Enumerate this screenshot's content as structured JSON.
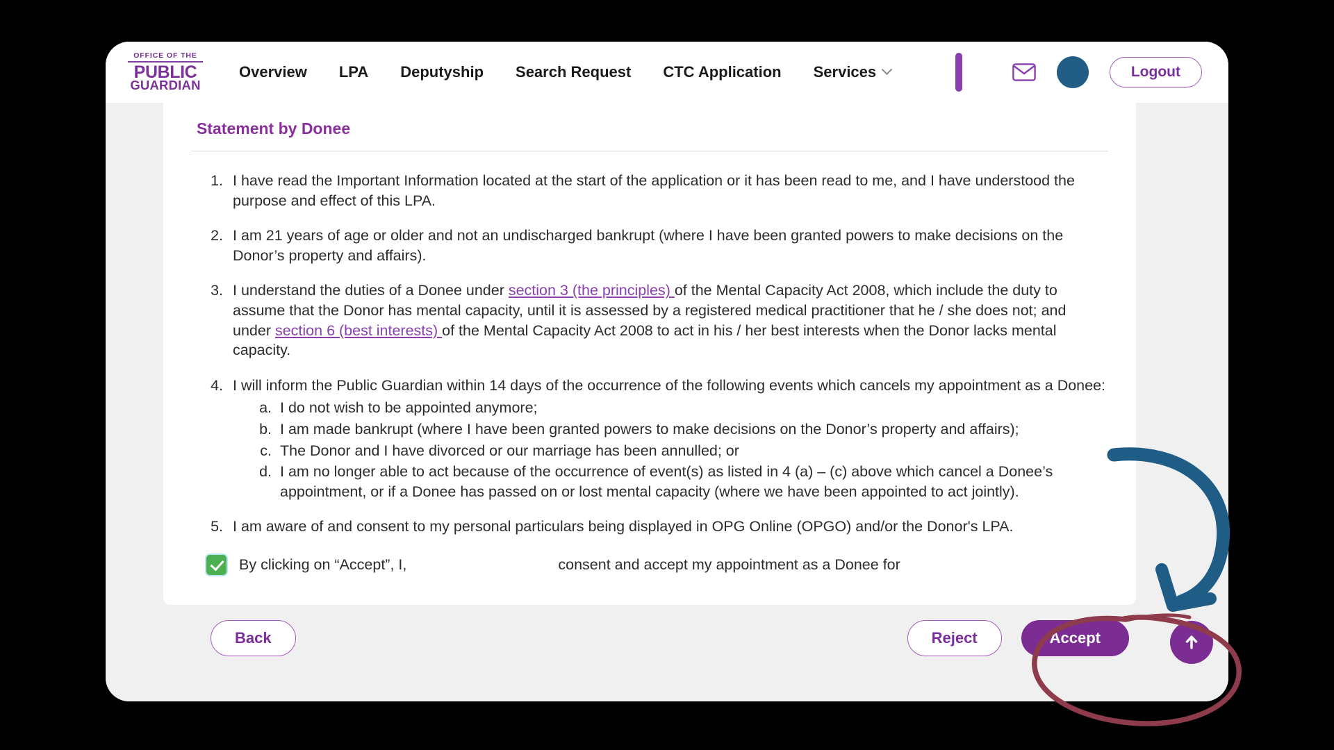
{
  "header": {
    "logo": {
      "line1": "OFFICE OF THE",
      "line2": "PUBLIC",
      "line3": "GUARDIAN"
    },
    "nav": [
      {
        "label": "Overview",
        "has_caret": false
      },
      {
        "label": "LPA",
        "has_caret": false
      },
      {
        "label": "Deputyship",
        "has_caret": false
      },
      {
        "label": "Search Request",
        "has_caret": false
      },
      {
        "label": "CTC Application",
        "has_caret": false
      },
      {
        "label": "Services",
        "has_caret": true
      }
    ],
    "mail_icon": "envelope-icon",
    "avatar": "user-avatar",
    "logout_label": "Logout"
  },
  "content": {
    "section_title": "Statement by Donee",
    "items": [
      {
        "n": 1,
        "parts": [
          {
            "t": "text",
            "v": "I have read the Important Information located at the start of the application or it has been read to me, and I have understood the purpose and effect of this LPA."
          }
        ]
      },
      {
        "n": 2,
        "parts": [
          {
            "t": "text",
            "v": "I am 21 years of age or older and not an undischarged bankrupt (where I have been granted powers to make decisions on the Donor’s property and affairs)."
          }
        ]
      },
      {
        "n": 3,
        "parts": [
          {
            "t": "text",
            "v": "I understand the duties of a Donee under "
          },
          {
            "t": "link",
            "v": "section 3 (the principles) "
          },
          {
            "t": "text",
            "v": "of the Mental Capacity Act 2008, which include the duty to assume that the Donor has mental capacity, until it is assessed by a registered medical practitioner that he / she does not; and under "
          },
          {
            "t": "link",
            "v": "section 6 (best interests) "
          },
          {
            "t": "text",
            "v": "of the Mental Capacity Act 2008 to act in his / her best interests when the Donor lacks mental capacity."
          }
        ]
      },
      {
        "n": 4,
        "parts": [
          {
            "t": "text",
            "v": "I will inform the Public Guardian within 14 days of the occurrence of the following events which cancels my appointment as a Donee:"
          }
        ],
        "sub": [
          "I do not wish to be appointed anymore;",
          "I am made bankrupt (where I have been granted powers to make decisions on the Donor’s property and affairs);",
          "The Donor and I have divorced or our marriage has been annulled; or",
          "I am no longer able to act because of the occurrence of event(s) as listed in 4 (a) – (c) above which cancel a Donee’s appointment, or if a Donee has passed on or lost mental capacity (where we have been appointed to act jointly)."
        ]
      },
      {
        "n": 5,
        "parts": [
          {
            "t": "text",
            "v": "I am aware of and consent to my personal particulars being displayed in OPG Online (OPGO) and/or the Donor's LPA."
          }
        ]
      }
    ],
    "consent": {
      "checked": true,
      "text_before": "By clicking on “Accept”, I,",
      "name_value": "",
      "text_after": "consent and accept my appointment as a Donee for"
    }
  },
  "buttons": {
    "back": "Back",
    "reject": "Reject",
    "accept": "Accept",
    "scroll_top": "scroll-to-top"
  },
  "colors": {
    "brand_purple": "#7b2d93",
    "logo_purple": "#7a3299",
    "link_purple": "#8a3fae",
    "title_purple": "#8b2f9e",
    "avatar_blue": "#215d85",
    "checkbox_green": "#4caf50",
    "annotation_blue": "#1f5c86",
    "annotation_red": "#8e3b4c",
    "page_bg": "#f0f0f0",
    "card_bg": "#ffffff"
  },
  "annotations": [
    {
      "name": "curved-arrow-annotation",
      "color": "#1f5c86",
      "shape": "arrow-curve-down-left"
    },
    {
      "name": "ellipse-highlight-annotation",
      "color": "#8e3b4c",
      "shape": "hand-drawn-ellipse"
    }
  ]
}
